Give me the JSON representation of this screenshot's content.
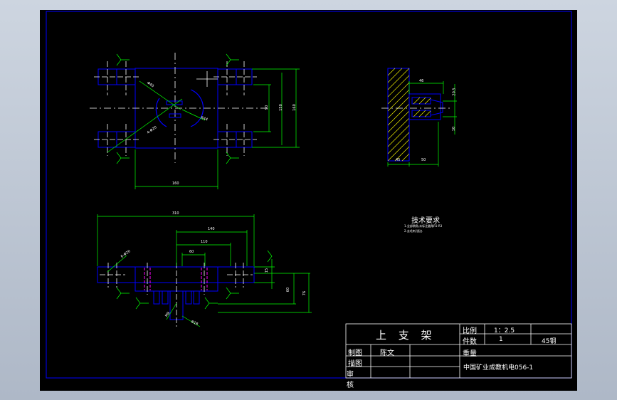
{
  "title_block": {
    "part_name": "上 支 架",
    "scale_label": "比例",
    "scale_value": "1：2.5",
    "quantity_label": "件数",
    "quantity_value": "1",
    "material": "45钢",
    "weight_label": "重量",
    "drawn_by_label": "制图",
    "drawn_by": "陈文",
    "traced_by_label": "描图",
    "reviewed_by_label": "审",
    "reviewed_by_label2": "核",
    "company": "中国矿业成教机电056-1"
  },
  "tech_notes": {
    "title": "技术要求",
    "line1": "1.全部倒角,未标注圆角R1-R3",
    "line2": "2.去毛刺,锐边."
  },
  "dimensions": {
    "d_90": "90",
    "d_150": "150",
    "d_160v": "160",
    "d_160h": "160",
    "d_phi40": "Φ40",
    "d_r44": "R44",
    "d_4phi20": "4-Φ20",
    "d_46": "46",
    "d_20": "20.5",
    "d_10": "10",
    "d_45": "45",
    "d_50": "50",
    "d_310": "310",
    "d_140": "140",
    "d_110": "110",
    "d_60": "60",
    "d_15": "15",
    "d_60v": "60",
    "d_76": "76",
    "d_6phi20": "6-Φ20",
    "d_phi18": "Φ18",
    "d_m8": "M8"
  },
  "colors": {
    "background": "#000000",
    "border": "#0000ff",
    "dimension": "#00ff00",
    "hidden": "#ff00ff",
    "text": "#ffffff"
  }
}
